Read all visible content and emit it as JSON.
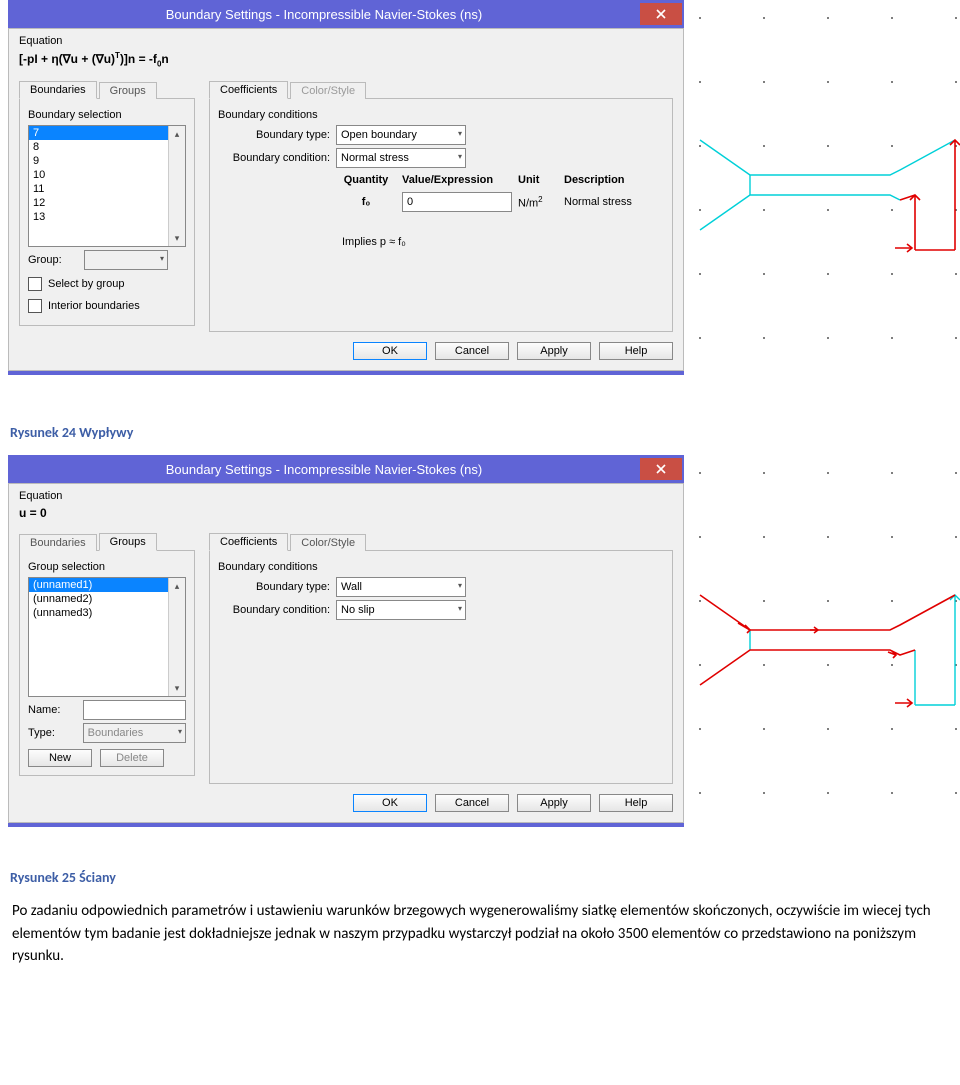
{
  "dialog1": {
    "title": "Boundary Settings - Incompressible Navier-Stokes (ns)",
    "equation_label": "Equation",
    "equation_html": "[-pI + η(∇u + (∇u)<sup>T</sup>)]n = -f<sub>0</sub>n",
    "left_tabs": [
      "Boundaries",
      "Groups"
    ],
    "left_tab_active": 0,
    "selection_label": "Boundary selection",
    "list_items": [
      "7",
      "8",
      "9",
      "10",
      "11",
      "12",
      "13"
    ],
    "list_selected": 0,
    "group_label": "Group:",
    "group_value": "",
    "chk_select_group": "Select by group",
    "chk_interior": "Interior boundaries",
    "right_tabs": [
      "Coefficients",
      "Color/Style"
    ],
    "right_tab_active": 0,
    "right_tab_disabled": [
      false,
      true
    ],
    "bc_label": "Boundary conditions",
    "btype_label": "Boundary type:",
    "btype_value": "Open boundary",
    "bcond_label": "Boundary condition:",
    "bcond_value": "Normal stress",
    "headers": {
      "q": "Quantity",
      "v": "Value/Expression",
      "u": "Unit",
      "d": "Description"
    },
    "row": {
      "q": "f₀",
      "v": "0",
      "u": "N/m²",
      "d": "Normal stress"
    },
    "implies": "Implies p ≈ f₀",
    "buttons": {
      "ok": "OK",
      "cancel": "Cancel",
      "apply": "Apply",
      "help": "Help"
    }
  },
  "caption1": "Rysunek 24 Wypływy",
  "dialog2": {
    "title": "Boundary Settings - Incompressible Navier-Stokes (ns)",
    "equation_label": "Equation",
    "equation_plain": "u = 0",
    "left_tabs": [
      "Boundaries",
      "Groups"
    ],
    "left_tab_active": 1,
    "selection_label": "Group selection",
    "list_items": [
      "(unnamed1)",
      "(unnamed2)",
      "(unnamed3)"
    ],
    "list_selected": 0,
    "name_label": "Name:",
    "name_value": "",
    "type_label": "Type:",
    "type_value": "Boundaries",
    "btn_new": "New",
    "btn_delete": "Delete",
    "right_tabs": [
      "Coefficients",
      "Color/Style"
    ],
    "right_tab_active": 0,
    "bc_label": "Boundary conditions",
    "btype_label": "Boundary type:",
    "btype_value": "Wall",
    "bcond_label": "Boundary condition:",
    "bcond_value": "No slip",
    "buttons": {
      "ok": "OK",
      "cancel": "Cancel",
      "apply": "Apply",
      "help": "Help"
    }
  },
  "caption2": "Rysunek 25 Ściany",
  "paragraph": "Po zadaniu odpowiednich parametrów i ustawieniu warunków brzegowych wygenerowaliśmy siatkę elementów skończonych, oczywiście im wiecej tych elementów tym badanie jest dokładniejsze jednak w naszym przypadku wystarczył podział na około 3500 elementów co przedstawiono na poniższym rysunku."
}
